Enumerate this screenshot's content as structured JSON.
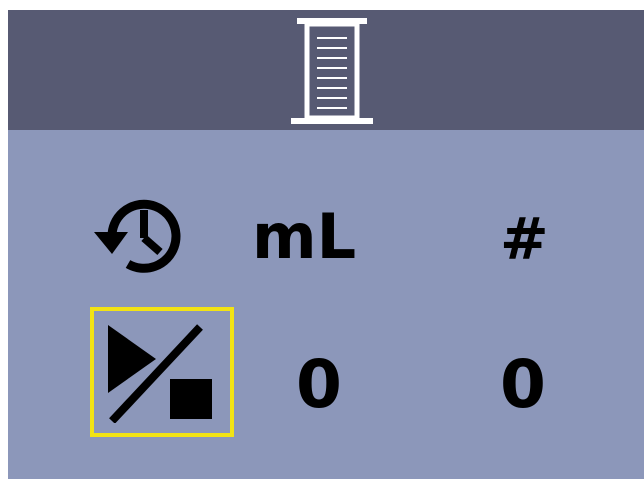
{
  "header": {
    "icon": "graduated-cylinder-icon"
  },
  "columns": {
    "history_icon": "history-clock-icon",
    "volume_label": "mL",
    "count_label": "#"
  },
  "row": {
    "toggle_icon": "play-stop-toggle-icon",
    "volume_value": "0",
    "count_value": "0"
  },
  "colors": {
    "header_bg": "#575a73",
    "panel_bg": "#8c97ba",
    "focus_border": "#f2e314"
  }
}
